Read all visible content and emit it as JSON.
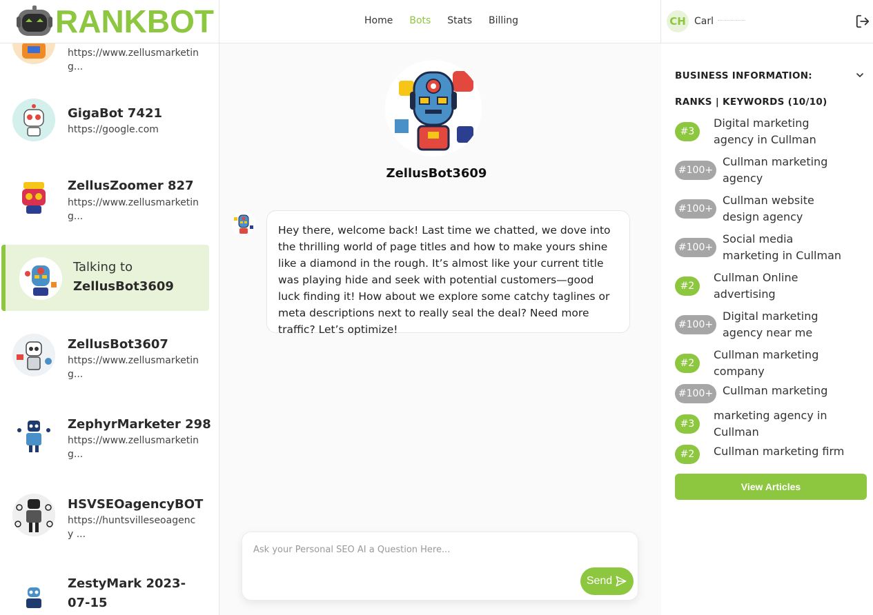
{
  "app": {
    "logo_text": "RANKBOT",
    "nav": [
      {
        "label": "Home",
        "active": false
      },
      {
        "label": "Bots",
        "active": true
      },
      {
        "label": "Stats",
        "active": false
      },
      {
        "label": "Billing",
        "active": false
      }
    ],
    "user": {
      "initials": "CH",
      "name": "Carl"
    },
    "accent_color": "#8dc63f",
    "badge_gray_color": "#a6a6a6"
  },
  "sidebar": {
    "partial_top_url": "https://www.zellusmarketin g...",
    "bots": [
      {
        "name": "GigaBot 7421",
        "url": "https://google.com"
      },
      {
        "name": "ZellusZoomer 827",
        "url": "https://www.zellusmarketin g..."
      },
      {
        "name": "ZellusBot3607",
        "url": "https://www.zellusmarketin g..."
      },
      {
        "name": "ZephyrMarketer 298",
        "url": "https://www.zellusmarketin g..."
      },
      {
        "name": "HSVSEOagencyBOT",
        "url": "https://huntsvilleseoagency ..."
      },
      {
        "name": "ZestyMark 2023-07-15",
        "url": ""
      }
    ],
    "active": {
      "talking_label": "Talking to",
      "name": "ZellusBot3609"
    }
  },
  "chat": {
    "bot_name": "ZellusBot3609",
    "message": "Hey there, welcome back! Last time we chatted, we dove into the thrilling world of page titles and how to make yours shine like a diamond in the rough. It’s almost like your current title was playing hide and seek with potential customers—good luck finding it! How about we explore some catchy taglines or meta descriptions next to really seal the deal? Need more traffic? Let’s optimize!",
    "input_placeholder": "Ask your Personal SEO AI a Question Here...",
    "input_value": "",
    "send_label": "Send"
  },
  "right_panel": {
    "business_title": "BUSINESS INFORMATION:",
    "ranks_title": "RANKS | KEYWORDS  (10/10)",
    "keywords": [
      {
        "rank": "#3",
        "keyword": "Digital marketing agency in Cullman",
        "status": "green"
      },
      {
        "rank": "#100+",
        "keyword": "Cullman marketing agency",
        "status": "gray"
      },
      {
        "rank": "#100+",
        "keyword": "Cullman website design agency",
        "status": "gray"
      },
      {
        "rank": "#100+",
        "keyword": "Social media marketing in Cullman",
        "status": "gray"
      },
      {
        "rank": "#2",
        "keyword": "Cullman Online advertising",
        "status": "green"
      },
      {
        "rank": "#100+",
        "keyword": "Digital marketing agency near me",
        "status": "gray"
      },
      {
        "rank": "#2",
        "keyword": "Cullman marketing company",
        "status": "green"
      },
      {
        "rank": "#100+",
        "keyword": "Cullman marketing",
        "status": "gray"
      },
      {
        "rank": "#3",
        "keyword": "marketing agency in Cullman",
        "status": "green"
      },
      {
        "rank": "#2",
        "keyword": "Cullman marketing firm",
        "status": "green"
      }
    ],
    "view_articles_label": "View Articles"
  }
}
